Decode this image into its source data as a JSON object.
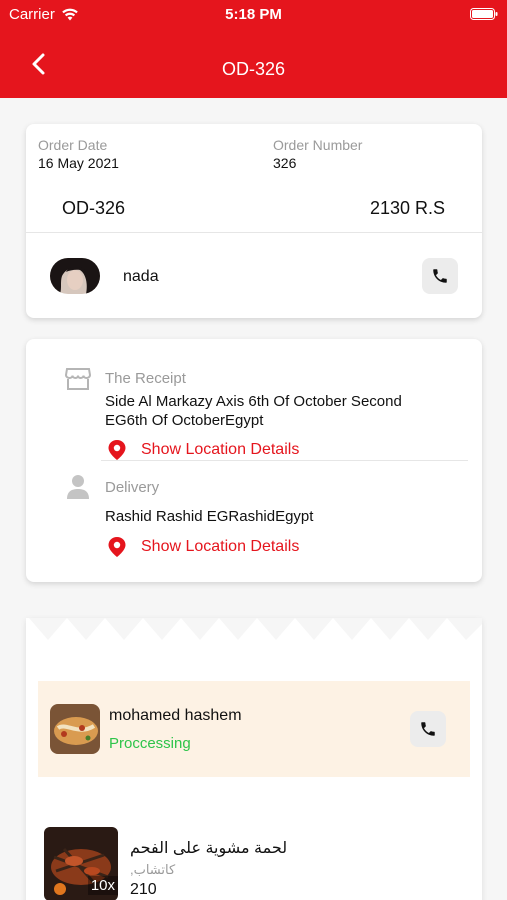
{
  "status_bar": {
    "carrier": "Carrier",
    "time": "5:18 PM"
  },
  "nav": {
    "title": "OD-326"
  },
  "order": {
    "date_label": "Order Date",
    "date_value": "16 May 2021",
    "number_label": "Order Number",
    "number_value": "326",
    "code": "OD-326",
    "total": "2130 R.S",
    "customer_name": "nada"
  },
  "addresses": {
    "receipt_label": "The Receipt",
    "receipt_line1": "Side Al Markazy Axis 6th Of October Second",
    "receipt_line2": "EG6th Of OctoberEgypt",
    "receipt_link": "Show Location Details",
    "delivery_label": "Delivery",
    "delivery_address": "Rashid Rashid EGRashidEgypt",
    "delivery_link": "Show Location Details"
  },
  "provider": {
    "name": "mohamed hashem",
    "status": "Proccessing",
    "status_color": "#2ec44a"
  },
  "product": {
    "name": "لحمة مشوية على الفحم",
    "subtitle": "كاتشاب,",
    "price": "210",
    "quantity": "10x"
  },
  "colors": {
    "brand": "#e5151d",
    "accent_bg": "#fdf2e4"
  }
}
